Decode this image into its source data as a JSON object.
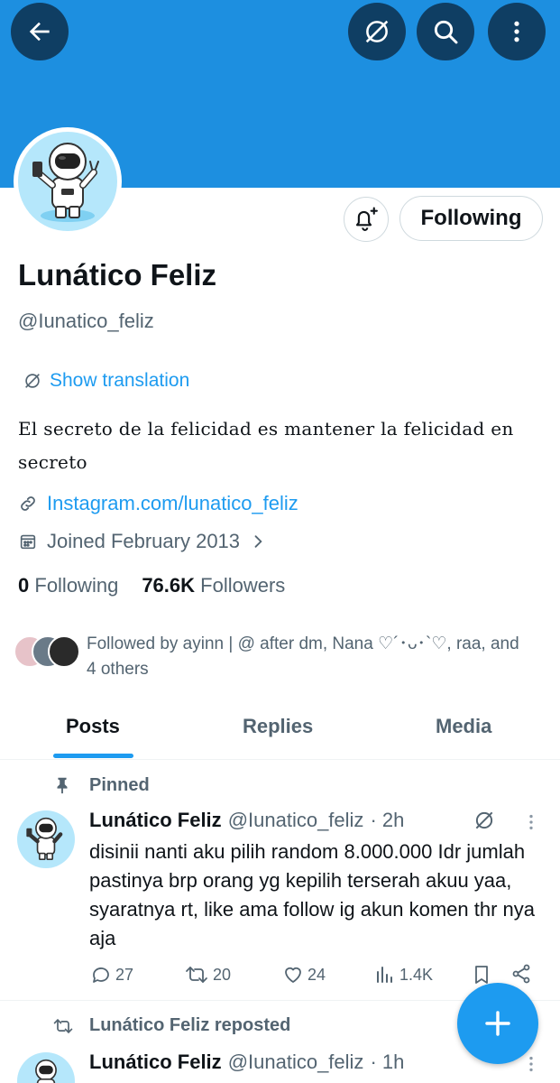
{
  "header": {
    "back_icon": "arrow-left-icon",
    "translate_icon": "translate-globe-icon",
    "search_icon": "search-icon",
    "more_icon": "more-vertical-icon",
    "banner_color": "#1d8fe0",
    "button_color": "#0f3e63"
  },
  "profile": {
    "name": "Lunático Feliz",
    "handle": "@Iunatico_feliz",
    "following_button": "Following",
    "show_translation": "Show translation",
    "bio": "El secreto de la felicidad es mantener la felicidad en secreto",
    "link": "Instagram.com/lunatico_feliz",
    "joined": "Joined February 2013",
    "following_count": "0",
    "following_label": "Following",
    "followers_count": "76.6K",
    "followers_label": "Followers",
    "followed_by": "Followed by ayinn | @ after dm, Nana ♡´･ᴗ･`♡, raa, and 4 others"
  },
  "tabs": [
    {
      "label": "Posts",
      "active": true
    },
    {
      "label": "Replies",
      "active": false
    },
    {
      "label": "Media",
      "active": false
    }
  ],
  "tweets": [
    {
      "context": "Pinned",
      "name": "Lunático Feliz",
      "handle": "@Iunatico_feliz",
      "time": "· 2h",
      "text": "disinii nanti aku pilih random 8.000.000 Idr jumlah pastinya brp orang yg kepilih terserah akuu yaa, syaratnya rt, like ama follow ig akun komen thr nya aja",
      "replies": "27",
      "retweets": "20",
      "likes": "24",
      "views": "1.4K"
    },
    {
      "context": "Lunático Feliz reposted",
      "name": "Lunático Feliz",
      "handle": "@Iunatico_feliz",
      "time": "· 1h"
    }
  ],
  "fab": {
    "icon": "plus-icon",
    "color": "#1d9bf0"
  },
  "accent": "#1d9bf0"
}
